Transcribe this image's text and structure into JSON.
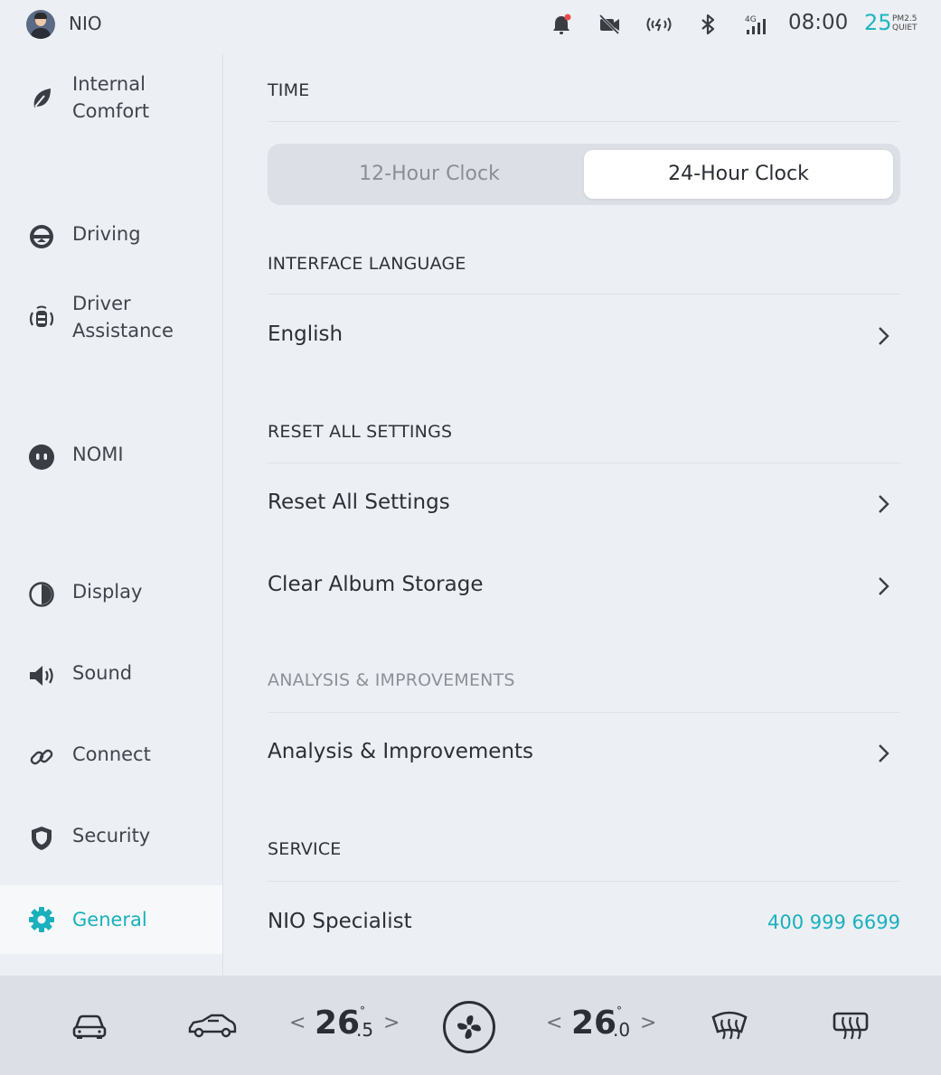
{
  "status_bar": {
    "brand": "NIO",
    "time": "08:00",
    "air_quality_value": "25",
    "air_quality_unit": "PM2.5",
    "air_quality_label": "QUIET",
    "network": "4G",
    "icons": [
      "notification-bell-icon",
      "camera-off-icon",
      "hotspot-icon",
      "bluetooth-icon",
      "signal-4g-icon"
    ]
  },
  "sidebar": {
    "items": [
      {
        "label": "Internal Comfort",
        "icon": "leaf-icon"
      },
      {
        "label": "Driving",
        "icon": "steering-wheel-icon"
      },
      {
        "label": "Driver Assistance",
        "icon": "driver-assist-icon"
      },
      {
        "label": "NOMI",
        "icon": "nomi-icon"
      },
      {
        "label": "Display",
        "icon": "display-icon"
      },
      {
        "label": "Sound",
        "icon": "speaker-icon"
      },
      {
        "label": "Connect",
        "icon": "link-icon"
      },
      {
        "label": "Security",
        "icon": "shield-icon"
      },
      {
        "label": "General",
        "icon": "gear-icon",
        "active": true
      }
    ],
    "accent_color": "#1ab0bd"
  },
  "main": {
    "time": {
      "title": "TIME",
      "options": [
        "12-Hour Clock",
        "24-Hour Clock"
      ],
      "selected": "24-Hour Clock"
    },
    "language": {
      "title": "INTERFACE LANGUAGE",
      "value": "English"
    },
    "reset": {
      "title": "RESET ALL SETTINGS",
      "rows": [
        "Reset All Settings",
        "Clear Album Storage"
      ]
    },
    "analysis": {
      "title": "ANALYSIS & IMPROVEMENTS",
      "row": "Analysis & Improvements"
    },
    "service": {
      "title": "SERVICE",
      "row_label": "NIO Specialist",
      "row_value": "400 999 6699"
    }
  },
  "bottom_bar": {
    "left_temp": {
      "whole": "26",
      "decimal": ".5",
      "degree": "°"
    },
    "right_temp": {
      "whole": "26",
      "decimal": ".0",
      "degree": "°"
    },
    "arrow_left": "<",
    "arrow_right": ">",
    "icons": [
      "car-icon",
      "car-open-icon",
      "fan-icon",
      "front-defrost-icon",
      "rear-defrost-icon"
    ]
  }
}
